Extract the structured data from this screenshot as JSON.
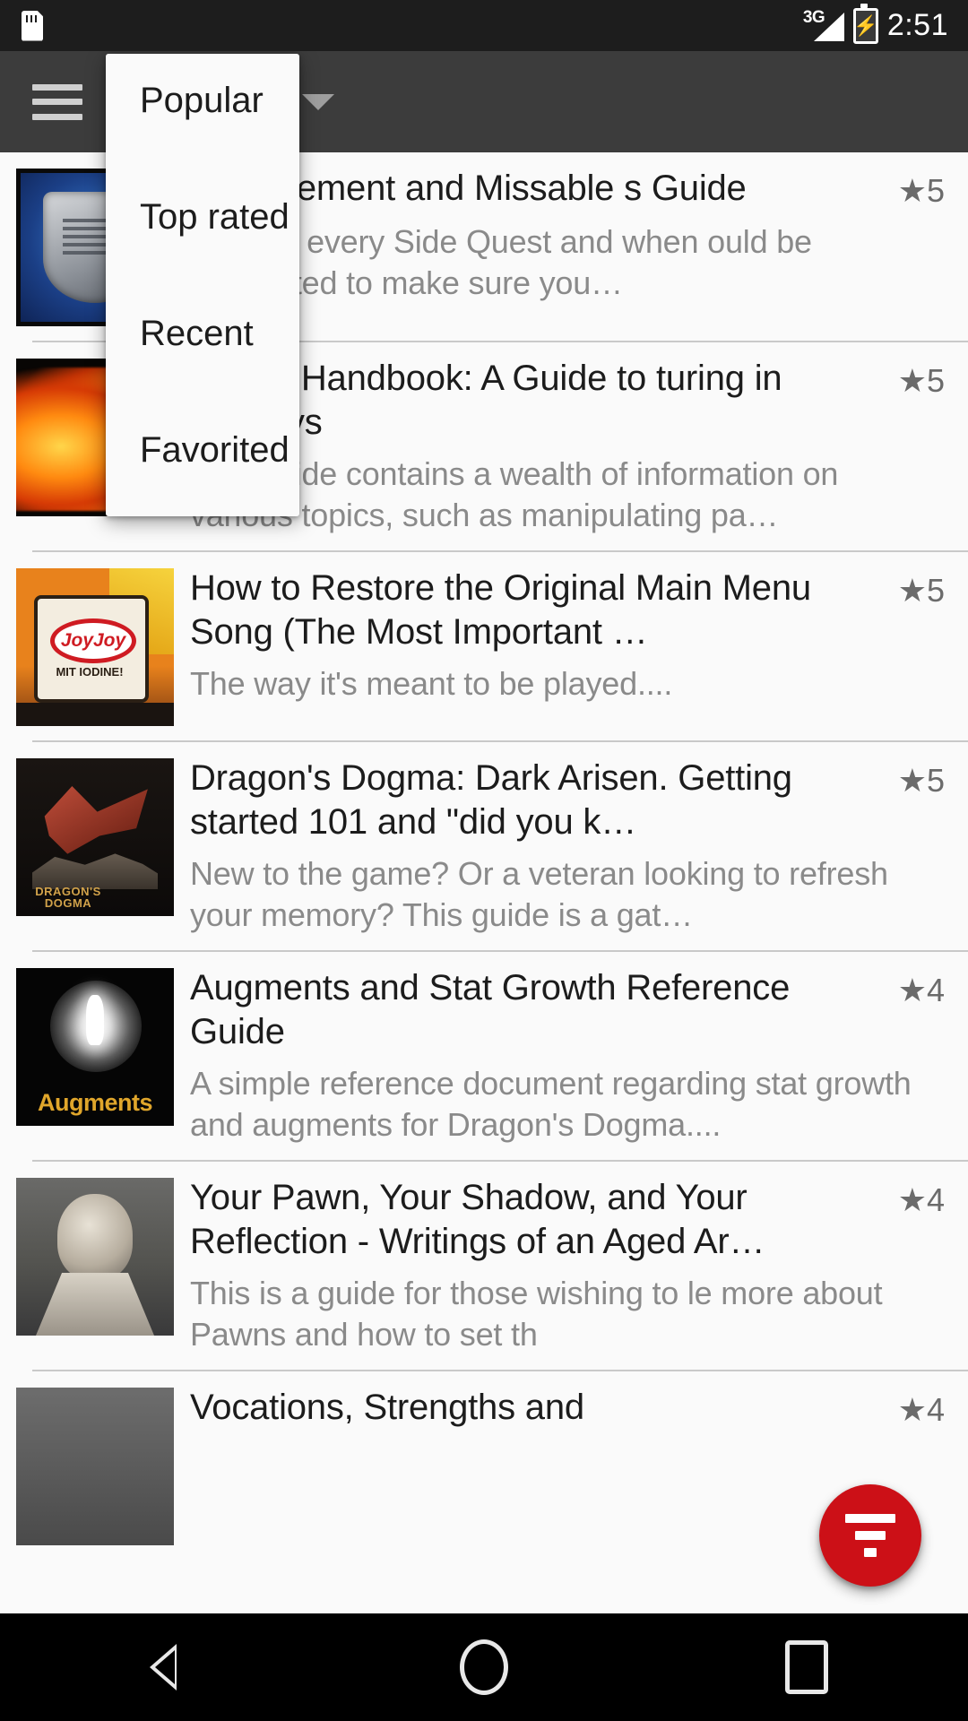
{
  "status_bar": {
    "sd_icon": "sd-card-icon",
    "network_label": "3G",
    "signal_icon": "signal-bars-icon",
    "battery_icon": "battery-charging-icon",
    "time": "2:51"
  },
  "toolbar": {
    "menu_icon": "hamburger-menu-icon",
    "spinner_caret_icon": "chevron-down-icon"
  },
  "sort_menu": {
    "items": [
      {
        "label": "Popular"
      },
      {
        "label": "Top rated"
      },
      {
        "label": "Recent"
      },
      {
        "label": "Favorited"
      }
    ]
  },
  "fab": {
    "icon": "filter-icon",
    "color": "#cc1017"
  },
  "guides": [
    {
      "title": "Achievement and Missable s Guide",
      "description": "e listing every Side Quest and when ould be completed to make sure you…",
      "rating": "5",
      "thumb": "shield-emblem-thumbnail"
    },
    {
      "title": "risen's Handbook: A Guide to turing in Gransys",
      "description": "This guide contains a wealth of information on various topics, such as manipulating pa…",
      "rating": "5",
      "thumb": "fire-phoenix-thumbnail"
    },
    {
      "title": "How to Restore the Original Main Menu Song (The Most Important …",
      "description": "The way it's meant to be played....",
      "rating": "5",
      "thumb": "joyjoy-box-thumbnail"
    },
    {
      "title": "Dragon's Dogma: Dark Arisen. Getting started 101 and \"did you k…",
      "description": "New to the game? Or a veteran looking to refresh your memory? This guide is a gat…",
      "rating": "5",
      "thumb": "red-dragon-thumbnail"
    },
    {
      "title": "Augments and Stat Growth Reference Guide",
      "description": "A simple reference document regarding stat growth and augments for Dragon's Dogma....",
      "rating": "4",
      "thumb": "augments-thumbnail"
    },
    {
      "title": "Your Pawn, Your Shadow, and Your Reflection - Writings of an Aged Ar…",
      "description": "This is a guide for those wishing to le more about Pawns and how to set th",
      "rating": "4",
      "thumb": "statue-thumbnail"
    },
    {
      "title": "Vocations, Strengths and",
      "description": "",
      "rating": "4",
      "thumb": "gray-thumbnail"
    }
  ],
  "thumb_art": {
    "joyjoy_brand": "JoyJoy",
    "joyjoy_sub": "MIT IODINE!",
    "dragon_logo_line1": "DRAGON'S",
    "dragon_logo_line2": "DOGMA",
    "augments_label": "Augments"
  },
  "nav_bar": {
    "back_icon": "nav-back-icon",
    "home_icon": "nav-home-icon",
    "recents_icon": "nav-recents-icon"
  }
}
